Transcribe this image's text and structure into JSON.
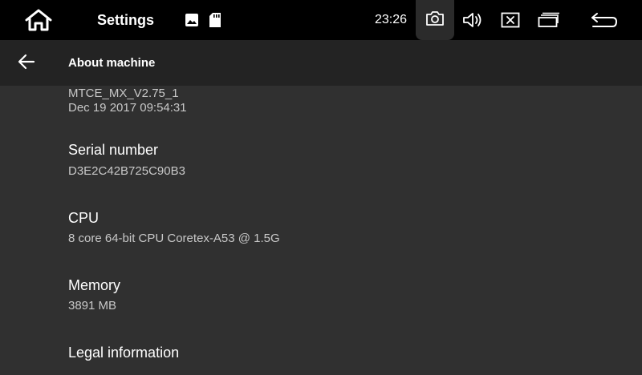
{
  "status_bar": {
    "title": "Settings",
    "time": "23:26",
    "icons": [
      "home-icon",
      "image-icon",
      "sd-card-icon",
      "camera-icon",
      "volume-icon",
      "close-window-icon",
      "recent-apps-icon",
      "back-return-icon"
    ]
  },
  "app_bar": {
    "title": "About machine",
    "back_icon": "arrow-left-icon"
  },
  "items": {
    "build": {
      "line1": "MTCE_MX_V2.75_1",
      "line2": "Dec 19 2017 09:54:31"
    },
    "serial": {
      "title": "Serial number",
      "value": "D3E2C42B725C90B3"
    },
    "cpu": {
      "title": "CPU",
      "value": "8 core 64-bit CPU Coretex-A53 @ 1.5G"
    },
    "memory": {
      "title": "Memory",
      "value": "3891 MB"
    },
    "legal": {
      "title": "Legal information"
    }
  },
  "colors": {
    "status_bar_bg": "#000000",
    "app_bar_bg": "#232323",
    "content_bg": "#303030",
    "secondary_text": "#c8c8c8"
  }
}
